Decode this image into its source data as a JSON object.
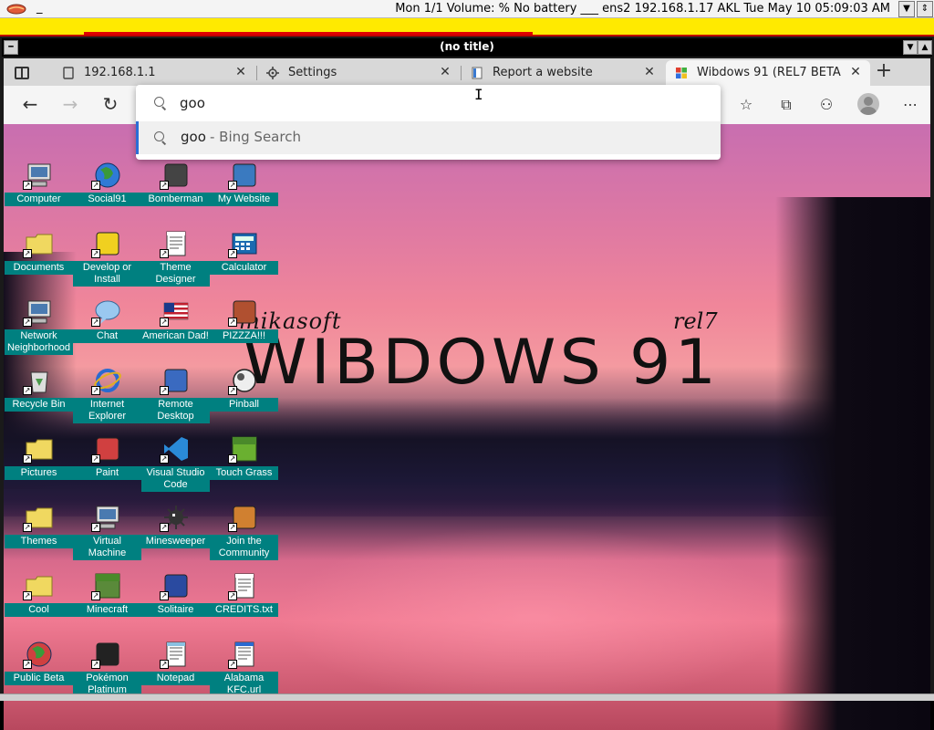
{
  "statusbar": {
    "left_dash": "_",
    "text": "Mon 1/1  Volume: %  No battery  ___ ens2 192.168.1.17  AKL Tue May 10 05:09:03 AM",
    "down_btn": "▼",
    "updown_btn": "⇕"
  },
  "window": {
    "title": "(no title)",
    "menu_btn": "━",
    "min_btn": "▼",
    "max_btn": "▲"
  },
  "tabs": [
    {
      "label": "192.168.1.1",
      "icon": "page-icon",
      "close": "✕"
    },
    {
      "label": "Settings",
      "icon": "gear-icon",
      "close": "✕"
    },
    {
      "label": "Report a website",
      "icon": "document-icon",
      "close": "✕"
    },
    {
      "label": "Wibdows 91 (REL7 BETA",
      "icon": "windows-logo-icon",
      "close": "✕"
    }
  ],
  "toolbar": {
    "back": "←",
    "forward": "→",
    "refresh": "↻",
    "favorites": "☆",
    "collections": "⧉",
    "extensions": "⚇",
    "more": "⋯"
  },
  "omnibox": {
    "value": "goo",
    "suggestion_query": "goo",
    "suggestion_engine": " - Bing Search"
  },
  "desktop": {
    "brand_company": "mikasoft",
    "brand_title": "WIBDOWS 91",
    "brand_release": "rel7",
    "icons": [
      {
        "label": "Computer",
        "icon": "computer-icon",
        "color": "#4a7ab0"
      },
      {
        "label": "Social91",
        "icon": "globe-icon",
        "color": "#2f7ad6"
      },
      {
        "label": "Bomberman",
        "icon": "bomb-icon",
        "color": "#444444"
      },
      {
        "label": "My Website",
        "icon": "web-icon",
        "color": "#3a7ac0"
      },
      {
        "label": "Documents",
        "icon": "folder-documents-icon",
        "color": "#f0d860"
      },
      {
        "label": "Develop or Install",
        "icon": "develop-icon",
        "color": "#f0d020"
      },
      {
        "label": "Theme Designer",
        "icon": "window-icon",
        "color": "#ffffff"
      },
      {
        "label": "Calculator",
        "icon": "calculator-icon",
        "color": "#1a6ab0"
      },
      {
        "label": "Network Neighborhood",
        "icon": "network-icon",
        "color": "#4a7ab0"
      },
      {
        "label": "Chat",
        "icon": "chat-icon",
        "color": "#9ac8f0"
      },
      {
        "label": "American Dad!",
        "icon": "flag-icon",
        "color": "#c02030"
      },
      {
        "label": "PIZZZA!!!",
        "icon": "pizza-icon",
        "color": "#b05030"
      },
      {
        "label": "Recycle Bin",
        "icon": "recycle-bin-icon",
        "color": "#4a9a4a"
      },
      {
        "label": "Internet Explorer",
        "icon": "internet-explorer-icon",
        "color": "#2a6ad0"
      },
      {
        "label": "Remote Desktop",
        "icon": "remote-desktop-icon",
        "color": "#3a6ac0"
      },
      {
        "label": "Pinball",
        "icon": "pinball-icon",
        "color": "#555555"
      },
      {
        "label": "Pictures",
        "icon": "folder-icon",
        "color": "#f0d860"
      },
      {
        "label": "Paint",
        "icon": "paint-icon",
        "color": "#d04040"
      },
      {
        "label": "Visual Studio Code",
        "icon": "vscode-icon",
        "color": "#2a8ad8"
      },
      {
        "label": "Touch Grass",
        "icon": "grass-icon",
        "color": "#6ab030"
      },
      {
        "label": "Themes",
        "icon": "folder-icon",
        "color": "#f0d860"
      },
      {
        "label": "Virtual Machine",
        "icon": "virtual-machine-icon",
        "color": "#4a7ab0"
      },
      {
        "label": "Minesweeper",
        "icon": "mine-icon",
        "color": "#333333"
      },
      {
        "label": "Join the Community",
        "icon": "community-icon",
        "color": "#d08030"
      },
      {
        "label": "Cool",
        "icon": "folder-icon",
        "color": "#f0d860"
      },
      {
        "label": "Minecraft",
        "icon": "minecraft-icon",
        "color": "#5a8a3a"
      },
      {
        "label": "Solitaire",
        "icon": "cards-icon",
        "color": "#2a4aa0"
      },
      {
        "label": "CREDITS.txt",
        "icon": "text-file-icon",
        "color": "#ffffff"
      },
      {
        "label": "Public Beta",
        "icon": "globe-icon",
        "color": "#d04040"
      },
      {
        "label": "Pokémon Platinum",
        "icon": "pokemon-icon",
        "color": "#222222"
      },
      {
        "label": "Notepad",
        "icon": "notepad-icon",
        "color": "#8ac0e0"
      },
      {
        "label": "Alabama KFC.url",
        "icon": "url-file-icon",
        "color": "#2a6ad0"
      }
    ]
  },
  "colors": {
    "icon_label_bg": "#008080",
    "yellow_bar": "#ffea00",
    "frame_red": "#c00000",
    "accent_blue": "#2b6fd6"
  }
}
